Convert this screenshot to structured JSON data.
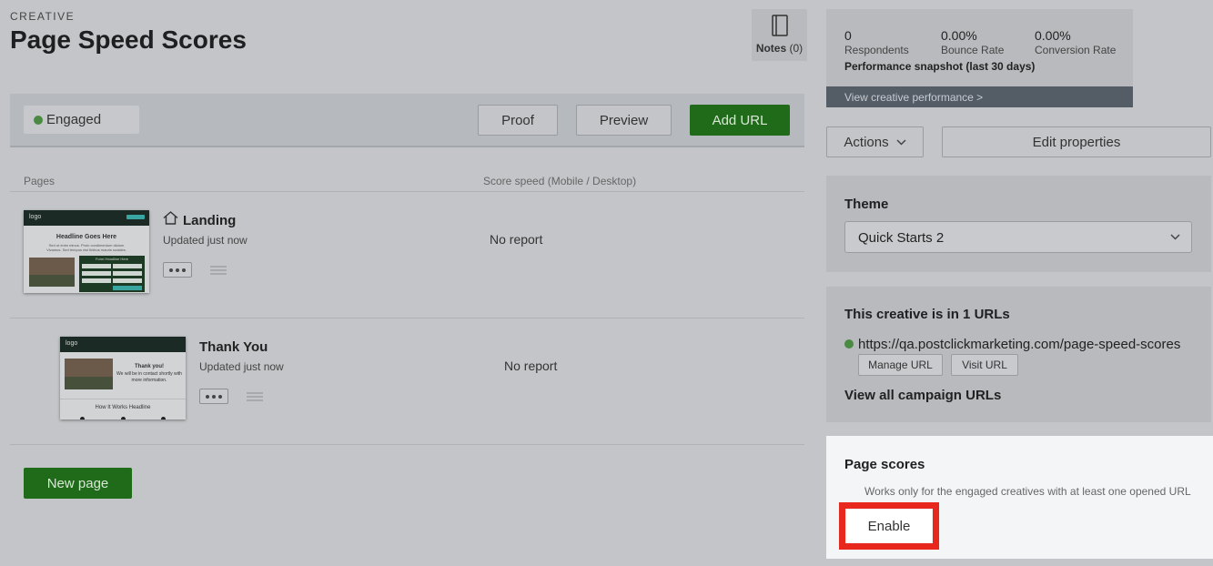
{
  "header": {
    "eyebrow": "CREATIVE",
    "title": "Page Speed Scores",
    "notes_label": "Notes",
    "notes_count": "(0)"
  },
  "toolbar": {
    "status": "Engaged",
    "proof": "Proof",
    "preview": "Preview",
    "add_url": "Add URL"
  },
  "pages": {
    "col_pages": "Pages",
    "col_score": "Score speed (Mobile / Desktop)",
    "items": [
      {
        "name": "Landing",
        "updated": "Updated just now",
        "score": "No report",
        "thumb": {
          "logo": "logo",
          "headline": "Headline Goes Here",
          "body": "Sed ut enim minus. Proin condimentum dictum Vivamus. Sed tempus nisi finibus mauris sodales.",
          "form_title": "Form Headline Here"
        }
      },
      {
        "name": "Thank You",
        "updated": "Updated just now",
        "score": "No report",
        "thumb": {
          "logo": "logo",
          "heading": "Thank you!",
          "body": "We will be in contact shortly with more information.",
          "footer": "How It Works Headline"
        }
      }
    ],
    "new_page": "New page"
  },
  "performance": {
    "respondents_value": "0",
    "respondents_label": "Respondents",
    "bounce_value": "0.00%",
    "bounce_label": "Bounce Rate",
    "conversion_value": "0.00%",
    "conversion_label": "Conversion Rate",
    "snapshot": "Performance snapshot (last 30 days)",
    "link": "View creative performance >"
  },
  "actions": {
    "actions_label": "Actions",
    "edit_label": "Edit properties"
  },
  "theme": {
    "title": "Theme",
    "selected": "Quick Starts 2"
  },
  "urls": {
    "title": "This creative is in 1 URLs",
    "url": "https://qa.postclickmarketing.com/page-speed-scores",
    "manage": "Manage URL",
    "visit": "Visit URL",
    "view_all": "View all campaign URLs"
  },
  "scores": {
    "title": "Page scores",
    "description": "Works only for the engaged creatives with at least one opened URL",
    "enable": "Enable"
  },
  "colors": {
    "green_button": "#1f6b1a",
    "highlight": "#e8271d",
    "status_dot": "#4a8a42"
  }
}
